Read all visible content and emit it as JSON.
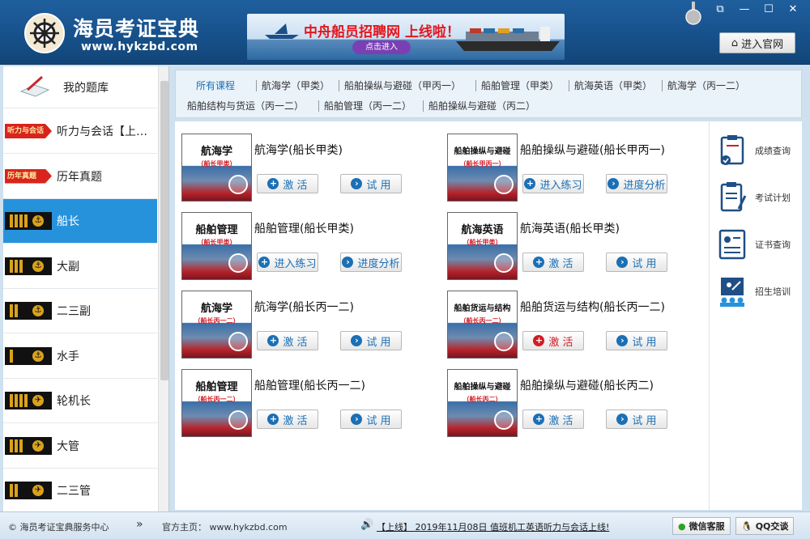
{
  "header": {
    "title": "海员考证宝典",
    "url": "www.hykzbd.com",
    "banner_text": "中舟船员招聘网 上线啦！",
    "banner_button": "点击进入",
    "enter_site": "进入官网"
  },
  "sidebar": {
    "header_label": "我的题库",
    "items": [
      {
        "label": "听力与会话【上…",
        "badge": "听力与会话",
        "type": "tag"
      },
      {
        "label": "历年真题",
        "badge": "历年真题",
        "type": "tag"
      },
      {
        "label": "船长",
        "type": "rank",
        "stripes": 4,
        "active": true
      },
      {
        "label": "大副",
        "type": "rank",
        "stripes": 3
      },
      {
        "label": "二三副",
        "type": "rank",
        "stripes": 2
      },
      {
        "label": "水手",
        "type": "rank",
        "stripes": 1
      },
      {
        "label": "轮机长",
        "type": "rank",
        "stripes": 4
      },
      {
        "label": "大管",
        "type": "rank",
        "stripes": 3
      },
      {
        "label": "二三管",
        "type": "rank",
        "stripes": 2
      }
    ]
  },
  "tabs": [
    "所有课程",
    "航海学（甲类）",
    "船舶操纵与避碰（甲丙一）",
    "船舶管理（甲类）",
    "航海英语（甲类）",
    "航海学（丙一二）",
    "船舶结构与货运（丙一二）",
    "船舶管理（丙一二）",
    "船舶操纵与避碰（丙二）"
  ],
  "courses": [
    {
      "title": "航海学(船长甲类)",
      "cover_title": "航海学",
      "cover_sub": "（船长甲类）",
      "btn1": "激 活",
      "btn2": "试 用"
    },
    {
      "title": "船舶操纵与避碰(船长甲丙一)",
      "cover_title": "船舶操纵与避碰",
      "cover_sub": "（船长甲丙一）",
      "btn1": "进入练习",
      "btn2": "进度分析"
    },
    {
      "title": "船舶管理(船长甲类)",
      "cover_title": "船舶管理",
      "cover_sub": "（船长甲类）",
      "btn1": "进入练习",
      "btn2": "进度分析"
    },
    {
      "title": "航海英语(船长甲类)",
      "cover_title": "航海英语",
      "cover_sub": "（船长甲类）",
      "btn1": "激 活",
      "btn2": "试 用"
    },
    {
      "title": "航海学(船长丙一二)",
      "cover_title": "航海学",
      "cover_sub": "（船长丙一二）",
      "btn1": "激 活",
      "btn2": "试 用"
    },
    {
      "title": "船舶货运与结构(船长丙一二)",
      "cover_title": "船舶货运与结构",
      "cover_sub": "（船长丙一二）",
      "btn1": "激 活",
      "btn2": "试 用",
      "btn1_red": true
    },
    {
      "title": "船舶管理(船长丙一二)",
      "cover_title": "船舶管理",
      "cover_sub": "（船长丙一二）",
      "btn1": "激 活",
      "btn2": "试 用"
    },
    {
      "title": "船舶操纵与避碰(船长丙二)",
      "cover_title": "船舶操纵与避碰",
      "cover_sub": "（船长丙二）",
      "btn1": "激 活",
      "btn2": "试 用"
    }
  ],
  "right_panel": [
    "成绩查询",
    "考试计划",
    "证书查询",
    "招生培训"
  ],
  "footer": {
    "copyright": "© 海员考证宝典服务中心",
    "homepage": "官方主页： www.hykzbd.com",
    "notice": "【上线】 2019年11月08日 值班机工英语听力与会话上线!",
    "wechat": "微信客服",
    "qq": "QQ交谈"
  },
  "colors": {
    "accent": "#2792dc",
    "header": "#17518b",
    "red": "#d21c24",
    "gold": "#d9a21b"
  }
}
